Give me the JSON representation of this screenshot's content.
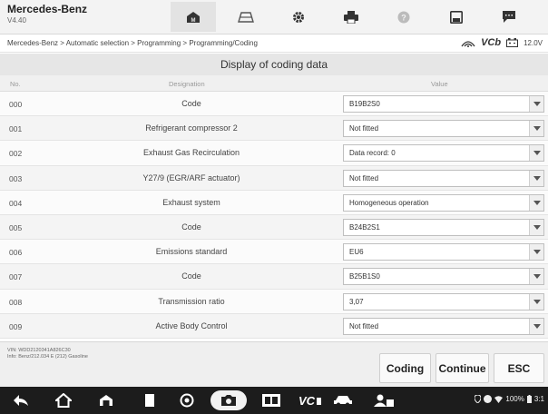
{
  "app": {
    "title": "Mercedes-Benz",
    "version": "V4.40"
  },
  "toolbar": [
    {
      "icon": "home-icon"
    },
    {
      "icon": "car-icon"
    },
    {
      "icon": "gear-icon"
    },
    {
      "icon": "printer-icon"
    },
    {
      "icon": "help-icon"
    },
    {
      "icon": "save-icon"
    },
    {
      "icon": "message-icon"
    }
  ],
  "breadcrumb": "Mercedes-Benz > Automatic selection > Programming > Programming/Coding",
  "vci": {
    "label": "VCb",
    "voltage": "12.0V"
  },
  "page_title": "Display of coding data",
  "columns": {
    "no": "No.",
    "designation": "Designation",
    "value": "Value"
  },
  "rows": [
    {
      "no": "000",
      "designation": "Code",
      "value": "B19B2S0"
    },
    {
      "no": "001",
      "designation": "Refrigerant compressor 2",
      "value": "Not fitted"
    },
    {
      "no": "002",
      "designation": "Exhaust Gas Recirculation",
      "value": "Data record: 0"
    },
    {
      "no": "003",
      "designation": "Y27/9 (EGR/ARF actuator)",
      "value": "Not fitted"
    },
    {
      "no": "004",
      "designation": "Exhaust system",
      "value": "Homogeneous operation"
    },
    {
      "no": "005",
      "designation": "Code",
      "value": "B24B2S1"
    },
    {
      "no": "006",
      "designation": "Emissions standard",
      "value": "EU6"
    },
    {
      "no": "007",
      "designation": "Code",
      "value": "B25B1S0"
    },
    {
      "no": "008",
      "designation": "Transmission ratio",
      "value": "3,07"
    },
    {
      "no": "009",
      "designation": "Active Body Control",
      "value": "Not fitted"
    }
  ],
  "vehicle_info": {
    "vin": "VIN: WDD2120341A826C30",
    "info": "Info: Benz/212.034 E (212) Gasoline"
  },
  "buttons": {
    "coding": "Coding",
    "continue": "Continue",
    "esc": "ESC"
  },
  "status": {
    "battery": "100%",
    "time": "3:1"
  }
}
